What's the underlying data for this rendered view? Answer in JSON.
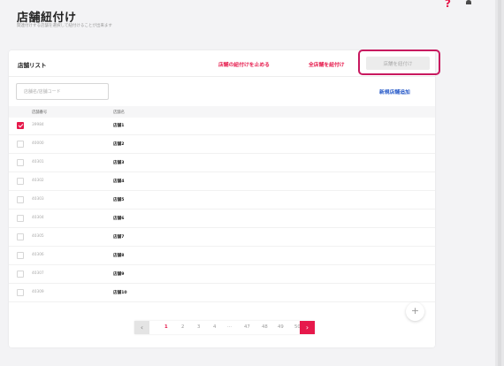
{
  "header": {
    "title": "店舗紐付け",
    "subtitle": "関連付けする店舗を選択して紐付けることが出来ます",
    "help_icon": "?"
  },
  "card": {
    "title": "店舗リスト",
    "stop_link_label": "店舗の紐付けを止める",
    "link_all_label": "全店舗を紐付け",
    "link_label": "店舗を紐付け",
    "search": {
      "placeholder": "店舗名/店舗コード",
      "value": ""
    },
    "new_store_label": "新規店舗追加"
  },
  "table": {
    "headers": {
      "no": "店舗番号",
      "name": "店舗名"
    },
    "rows": [
      {
        "no": "39984",
        "name": "店舗1",
        "checked": true
      },
      {
        "no": "40000",
        "name": "店舗2",
        "checked": false
      },
      {
        "no": "40301",
        "name": "店舗3",
        "checked": false
      },
      {
        "no": "40302",
        "name": "店舗4",
        "checked": false
      },
      {
        "no": "40303",
        "name": "店舗5",
        "checked": false
      },
      {
        "no": "40304",
        "name": "店舗6",
        "checked": false
      },
      {
        "no": "40305",
        "name": "店舗7",
        "checked": false
      },
      {
        "no": "40306",
        "name": "店舗8",
        "checked": false
      },
      {
        "no": "40307",
        "name": "店舗9",
        "checked": false
      },
      {
        "no": "40309",
        "name": "店舗10",
        "checked": false
      }
    ]
  },
  "fab": {
    "label": "+"
  },
  "pagination": {
    "prev": "‹",
    "next": "›",
    "pages": [
      "1",
      "2",
      "3",
      "4",
      "···",
      "47",
      "48",
      "49",
      "50"
    ],
    "active": "1"
  },
  "colors": {
    "accent": "#e6194b",
    "link": "#2659c8",
    "highlight_border": "#c8185f"
  }
}
